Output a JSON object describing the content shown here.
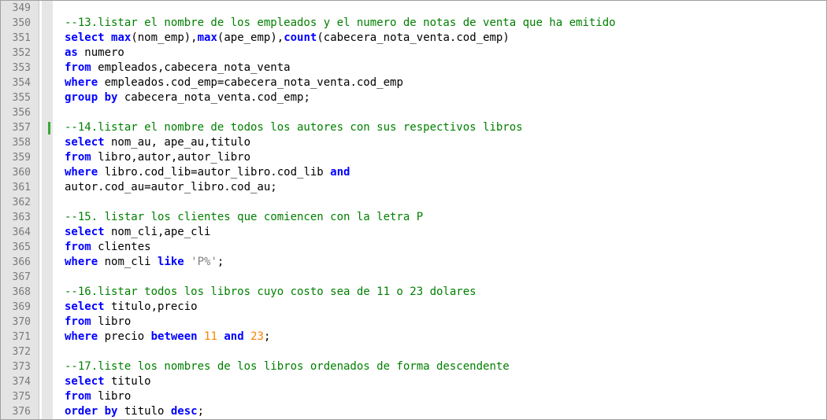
{
  "editor": {
    "change_marker_line": 357,
    "lines": [
      {
        "n": "349",
        "tokens": []
      },
      {
        "n": "350",
        "tokens": [
          {
            "t": "--13.listar el nombre de los empleados y el numero de notas de venta que ha emitido",
            "c": "cm"
          }
        ]
      },
      {
        "n": "351",
        "tokens": [
          {
            "t": "select",
            "c": "kw"
          },
          {
            "t": " ",
            "c": "txt"
          },
          {
            "t": "max",
            "c": "fn"
          },
          {
            "t": "(nom_emp),",
            "c": "txt"
          },
          {
            "t": "max",
            "c": "fn"
          },
          {
            "t": "(ape_emp),",
            "c": "txt"
          },
          {
            "t": "count",
            "c": "fn"
          },
          {
            "t": "(cabecera_nota_venta.cod_emp)",
            "c": "txt"
          }
        ]
      },
      {
        "n": "352",
        "tokens": [
          {
            "t": "as",
            "c": "kw"
          },
          {
            "t": " numero",
            "c": "txt"
          }
        ]
      },
      {
        "n": "353",
        "tokens": [
          {
            "t": "from",
            "c": "kw"
          },
          {
            "t": " empleados,cabecera_nota_venta",
            "c": "txt"
          }
        ]
      },
      {
        "n": "354",
        "tokens": [
          {
            "t": "where",
            "c": "kw"
          },
          {
            "t": " empleados.cod_emp=cabecera_nota_venta.cod_emp",
            "c": "txt"
          }
        ]
      },
      {
        "n": "355",
        "tokens": [
          {
            "t": "group by",
            "c": "kw"
          },
          {
            "t": " cabecera_nota_venta.cod_emp;",
            "c": "txt"
          }
        ]
      },
      {
        "n": "356",
        "tokens": []
      },
      {
        "n": "357",
        "tokens": [
          {
            "t": "--14.listar el nombre de todos los autores con sus respectivos libros",
            "c": "cm"
          }
        ]
      },
      {
        "n": "358",
        "tokens": [
          {
            "t": "select",
            "c": "kw"
          },
          {
            "t": " nom_au, ape_au,titulo",
            "c": "txt"
          }
        ]
      },
      {
        "n": "359",
        "tokens": [
          {
            "t": "from",
            "c": "kw"
          },
          {
            "t": " libro,autor,autor_libro",
            "c": "txt"
          }
        ]
      },
      {
        "n": "360",
        "tokens": [
          {
            "t": "where",
            "c": "kw"
          },
          {
            "t": " libro.cod_lib=autor_libro.cod_lib ",
            "c": "txt"
          },
          {
            "t": "and",
            "c": "kw"
          }
        ]
      },
      {
        "n": "361",
        "tokens": [
          {
            "t": "autor.cod_au=autor_libro.cod_au;",
            "c": "txt"
          }
        ]
      },
      {
        "n": "362",
        "tokens": []
      },
      {
        "n": "363",
        "tokens": [
          {
            "t": "--15. listar los clientes que comiencen con la letra P",
            "c": "cm"
          }
        ]
      },
      {
        "n": "364",
        "tokens": [
          {
            "t": "select",
            "c": "kw"
          },
          {
            "t": " nom_cli,ape_cli",
            "c": "txt"
          }
        ]
      },
      {
        "n": "365",
        "tokens": [
          {
            "t": "from",
            "c": "kw"
          },
          {
            "t": " clientes",
            "c": "txt"
          }
        ]
      },
      {
        "n": "366",
        "tokens": [
          {
            "t": "where",
            "c": "kw"
          },
          {
            "t": " nom_cli ",
            "c": "txt"
          },
          {
            "t": "like",
            "c": "kw"
          },
          {
            "t": " ",
            "c": "txt"
          },
          {
            "t": "'P%'",
            "c": "str"
          },
          {
            "t": ";",
            "c": "txt"
          }
        ]
      },
      {
        "n": "367",
        "tokens": []
      },
      {
        "n": "368",
        "tokens": [
          {
            "t": "--16.listar todos los libros cuyo costo sea de 11 o 23 dolares",
            "c": "cm"
          }
        ]
      },
      {
        "n": "369",
        "tokens": [
          {
            "t": "select",
            "c": "kw"
          },
          {
            "t": " titulo,precio",
            "c": "txt"
          }
        ]
      },
      {
        "n": "370",
        "tokens": [
          {
            "t": "from",
            "c": "kw"
          },
          {
            "t": " libro",
            "c": "txt"
          }
        ]
      },
      {
        "n": "371",
        "tokens": [
          {
            "t": "where",
            "c": "kw"
          },
          {
            "t": " precio ",
            "c": "txt"
          },
          {
            "t": "between",
            "c": "kw"
          },
          {
            "t": " ",
            "c": "txt"
          },
          {
            "t": "11",
            "c": "num"
          },
          {
            "t": " ",
            "c": "txt"
          },
          {
            "t": "and",
            "c": "kw"
          },
          {
            "t": " ",
            "c": "txt"
          },
          {
            "t": "23",
            "c": "num"
          },
          {
            "t": ";",
            "c": "txt"
          }
        ]
      },
      {
        "n": "372",
        "tokens": []
      },
      {
        "n": "373",
        "tokens": [
          {
            "t": "--17.liste los nombres de los libros ordenados de forma descendente",
            "c": "cm"
          }
        ]
      },
      {
        "n": "374",
        "tokens": [
          {
            "t": "select",
            "c": "kw"
          },
          {
            "t": " titulo",
            "c": "txt"
          }
        ]
      },
      {
        "n": "375",
        "tokens": [
          {
            "t": "from",
            "c": "kw"
          },
          {
            "t": " libro",
            "c": "txt"
          }
        ]
      },
      {
        "n": "376",
        "tokens": [
          {
            "t": "order by",
            "c": "kw"
          },
          {
            "t": " titulo ",
            "c": "txt"
          },
          {
            "t": "desc",
            "c": "kw"
          },
          {
            "t": ";",
            "c": "txt"
          }
        ]
      }
    ]
  },
  "colors": {
    "keyword": "#0000ff",
    "comment": "#008000",
    "number": "#ff8000",
    "string": "#808080",
    "gutter_bg": "#e4e4e4",
    "change_marker": "#3aa83a"
  }
}
